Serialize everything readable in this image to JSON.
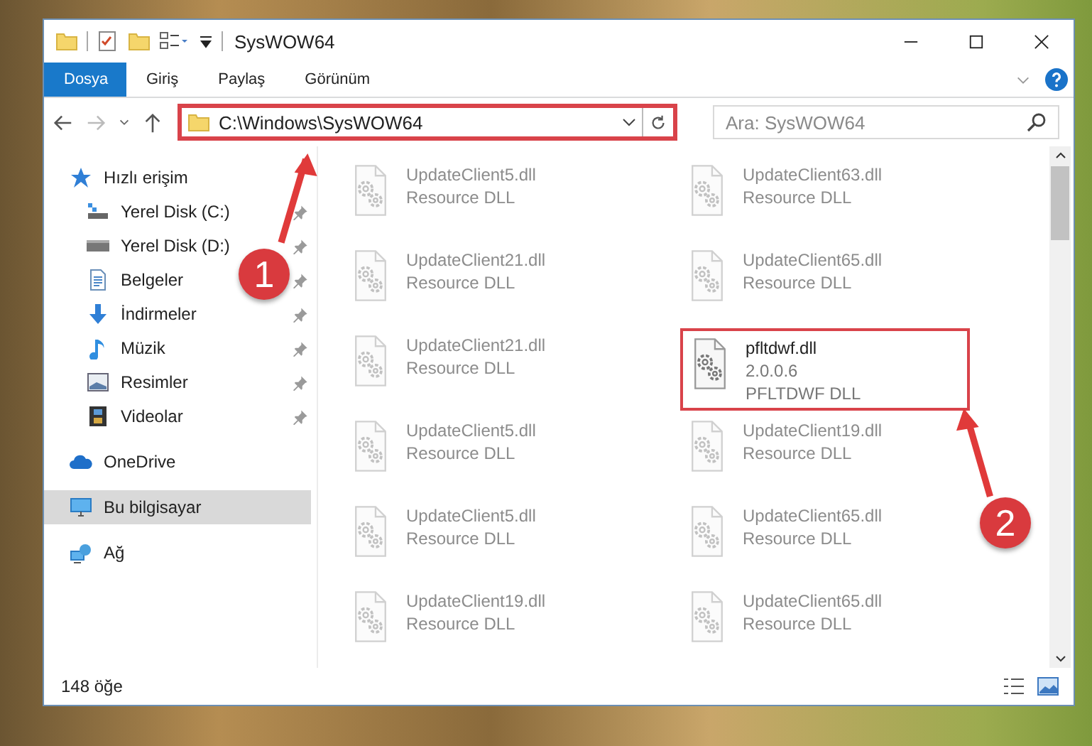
{
  "window": {
    "title": "SysWOW64"
  },
  "ribbon": {
    "tabs": [
      {
        "label": "Dosya",
        "selected": true
      },
      {
        "label": "Giriş",
        "selected": false
      },
      {
        "label": "Paylaş",
        "selected": false
      },
      {
        "label": "Görünüm",
        "selected": false
      }
    ]
  },
  "address_bar": {
    "path": "C:\\Windows\\SysWOW64",
    "highlighted": true
  },
  "search": {
    "placeholder": "Ara: SysWOW64"
  },
  "sidebar": {
    "sections": [
      {
        "label": "Hızlı erişim",
        "selected": false,
        "children": [
          {
            "label": "Yerel Disk (C:)",
            "pinned": true,
            "selected": false
          },
          {
            "label": "Yerel Disk (D:)",
            "pinned": true,
            "selected": false
          },
          {
            "label": "Belgeler",
            "pinned": true,
            "selected": false
          },
          {
            "label": "İndirmeler",
            "pinned": true,
            "selected": false
          },
          {
            "label": "Müzik",
            "pinned": true,
            "selected": false
          },
          {
            "label": "Resimler",
            "pinned": true,
            "selected": false
          },
          {
            "label": "Videolar",
            "pinned": true,
            "selected": false
          }
        ]
      },
      {
        "label": "OneDrive",
        "selected": false
      },
      {
        "label": "Bu bilgisayar",
        "selected": true
      },
      {
        "label": "Ağ",
        "selected": false
      }
    ]
  },
  "files": [
    {
      "name": "UpdateClient5.dll",
      "description": "Resource DLL",
      "faded": true,
      "highlighted": false
    },
    {
      "name": "UpdateClient63.dll",
      "description": "Resource DLL",
      "faded": true,
      "highlighted": false
    },
    {
      "name": "UpdateClient21.dll",
      "description": "Resource DLL",
      "faded": true,
      "highlighted": false
    },
    {
      "name": "UpdateClient65.dll",
      "description": "Resource DLL",
      "faded": true,
      "highlighted": false
    },
    {
      "name": "UpdateClient21.dll",
      "description": "Resource DLL",
      "faded": true,
      "highlighted": false
    },
    {
      "name": "pfltdwf.dll",
      "version": "2.0.0.6",
      "description": "PFLTDWF DLL",
      "faded": false,
      "highlighted": true
    },
    {
      "name": "UpdateClient5.dll",
      "description": "Resource DLL",
      "faded": true,
      "highlighted": false
    },
    {
      "name": "UpdateClient19.dll",
      "description": "Resource DLL",
      "faded": true,
      "highlighted": false
    },
    {
      "name": "UpdateClient5.dll",
      "description": "Resource DLL",
      "faded": true,
      "highlighted": false
    },
    {
      "name": "UpdateClient65.dll",
      "description": "Resource DLL",
      "faded": true,
      "highlighted": false
    },
    {
      "name": "UpdateClient19.dll",
      "description": "Resource DLL",
      "faded": true,
      "highlighted": false
    },
    {
      "name": "UpdateClient65.dll",
      "description": "Resource DLL",
      "faded": true,
      "highlighted": false
    }
  ],
  "status_bar": {
    "item_count": "148 öğe"
  },
  "annotations": [
    {
      "label": "1"
    },
    {
      "label": "2"
    }
  ]
}
